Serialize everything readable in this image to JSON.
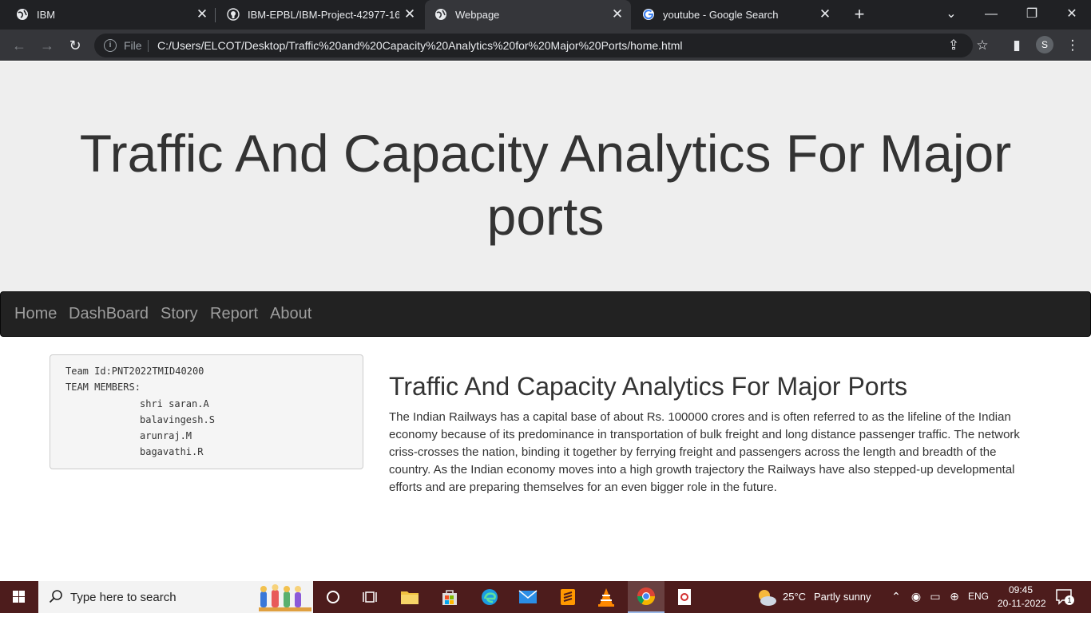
{
  "browser": {
    "tabs": [
      {
        "title": "IBM",
        "icon": "globe-icon",
        "active": false
      },
      {
        "title": "IBM-EPBL/IBM-Project-42977-16",
        "icon": "github-icon",
        "active": false
      },
      {
        "title": "Webpage",
        "icon": "globe-icon",
        "active": true
      },
      {
        "title": "youtube - Google Search",
        "icon": "google-icon",
        "active": false
      }
    ],
    "new_tab_label": "+",
    "address": {
      "scheme_label": "File",
      "url": "C:/Users/ELCOT/Desktop/Traffic%20and%20Capacity%20Analytics%20for%20Major%20Ports/home.html"
    },
    "profile_initial": "S"
  },
  "page": {
    "jumbotron_title": "Traffic And Capacity Analytics For Major ports",
    "nav": {
      "items": [
        "Home",
        "DashBoard",
        "Story",
        "Report",
        "About"
      ]
    },
    "team": {
      "team_id_line": "Team Id:PNT2022TMID40200",
      "members_heading": "TEAM MEMBERS:",
      "members": [
        "shri saran.A",
        "balavingesh.S",
        "arunraj.M",
        "bagavathi.R"
      ]
    },
    "content": {
      "heading": "Traffic And Capacity Analytics For Major Ports",
      "paragraph": "The Indian Railways has a capital base of about Rs. 100000 crores and is often referred to as the lifeline of the Indian economy because of its predominance in transportation of bulk freight and long distance passenger traffic. The network criss-crosses the nation, binding it together by ferrying freight and passengers across the length and breadth of the country. As the Indian economy moves into a high growth trajectory the Railways have also stepped-up developmental efforts and are preparing themselves for an even bigger role in the future."
    }
  },
  "taskbar": {
    "search_placeholder": "Type here to search",
    "weather": {
      "temp": "25°C",
      "condition": "Partly sunny"
    },
    "language": "ENG",
    "time": "09:45",
    "date": "20-11-2022",
    "notification_count": "1"
  },
  "colors": {
    "jumbotron_bg": "#eeeeee",
    "navbar_bg": "#222222",
    "navbar_link": "#9d9d9d",
    "taskbar_bg": "#4d1c1c",
    "tabbar_bg": "#202124",
    "toolbar_bg": "#35363a"
  }
}
